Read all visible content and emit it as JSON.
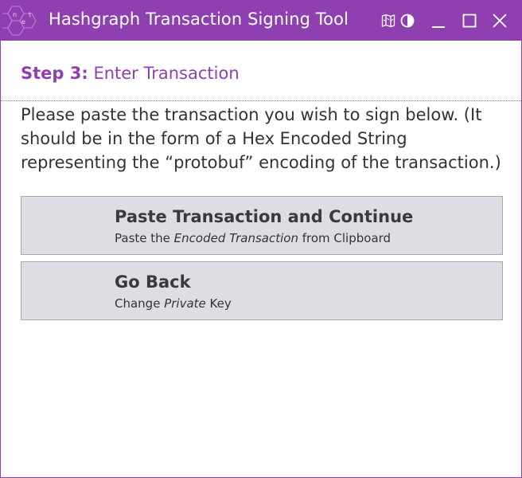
{
  "window": {
    "title": "Hashgraph Transaction Signing Tool",
    "accent_color": "#8e3fb0",
    "icons": [
      "app-logo-icon",
      "map-icon",
      "contrast-icon",
      "minimize-icon",
      "maximize-icon",
      "close-icon"
    ]
  },
  "step": {
    "number_label": "Step 3:",
    "title": "Enter Transaction"
  },
  "instructions": "Please paste the transaction you wish to sign below. (It should be in the form of a Hex Encoded String representing the “protobuf” encoding of the transaction.)",
  "actions": {
    "paste": {
      "title": "Paste Transaction and Continue",
      "sub_prefix": "Paste the ",
      "sub_emphasis": "Encoded Transaction",
      "sub_suffix": " from Clipboard"
    },
    "back": {
      "title": "Go Back",
      "sub_prefix": "Change ",
      "sub_emphasis": "Private",
      "sub_suffix": " Key"
    }
  }
}
